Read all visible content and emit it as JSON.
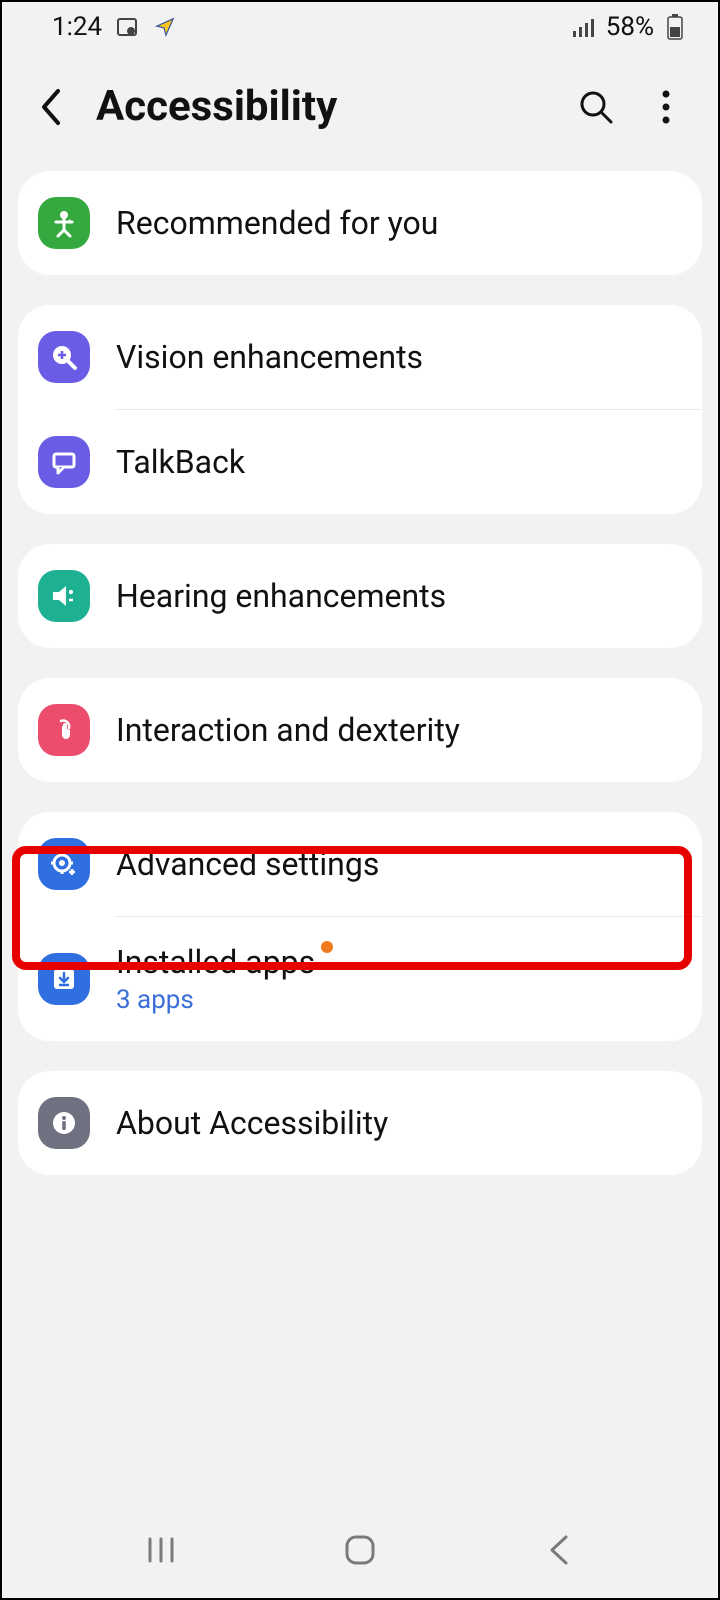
{
  "status": {
    "time": "1:24",
    "battery_text": "58%"
  },
  "header": {
    "title": "Accessibility"
  },
  "sections": {
    "recommended": "Recommended for you",
    "vision": "Vision enhancements",
    "talkback": "TalkBack",
    "hearing": "Hearing enhancements",
    "interaction": "Interaction and dexterity",
    "advanced": "Advanced settings",
    "installed": "Installed apps",
    "installed_sub": "3 apps",
    "about": "About Accessibility"
  },
  "colors": {
    "green": "#35a83f",
    "purple": "#6b5ce5",
    "teal": "#1db191",
    "pink": "#ec4d6d",
    "blue": "#2f6fe0",
    "grey": "#6f7180"
  }
}
